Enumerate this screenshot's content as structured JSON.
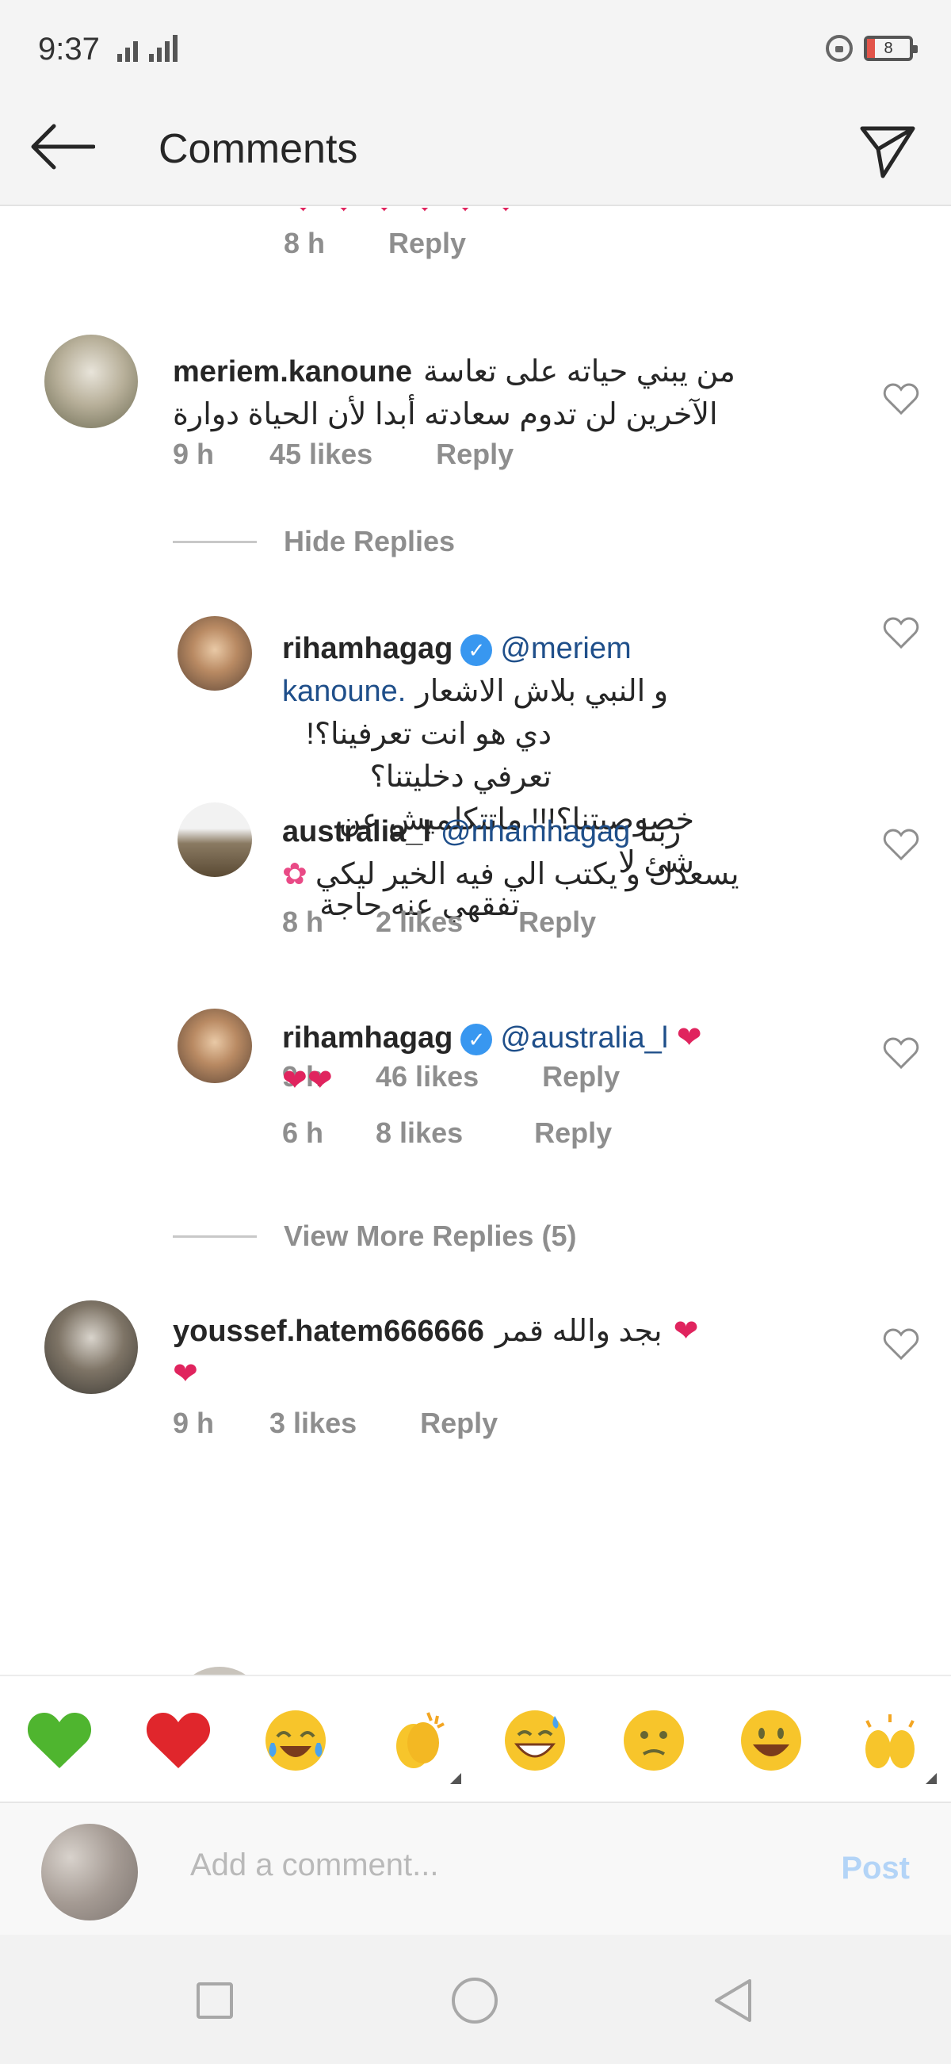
{
  "status_bar": {
    "time": "9:37",
    "battery": "8"
  },
  "header": {
    "title": "Comments"
  },
  "previous_comment": {
    "time": "8 h",
    "reply": "Reply"
  },
  "comments": [
    {
      "username": "meriem.kanoune",
      "text_line1": "من يبني حياته على تعاسة",
      "text_line2": "الآخرين لن تدوم سعادته أبدا لأن الحياة دوارة",
      "time": "9 h",
      "likes": "45 likes",
      "reply": "Reply"
    },
    {
      "username": "youssef.hatem666666",
      "text": "بجد والله قمر",
      "time": "9 h",
      "likes": "3 likes",
      "reply": "Reply"
    }
  ],
  "hide_replies": "Hide Replies",
  "replies": [
    {
      "username": "rihamhagag",
      "mention": "@meriem",
      "line2_rtl": "و النبي بلاش الاشعار",
      "line2_mention": "kanoune.",
      "line3": "دي هو انت تعرفينا؟! تعرفي دخليتنا؟",
      "line4": "خصوصيتنا؟!!! ماتتكلميش عن شئ لا",
      "line5": "تفقهي عنه حاجة",
      "time": "9 h",
      "likes": "46 likes",
      "reply": "Reply"
    },
    {
      "username": "australia_l",
      "mention": "@rihamhagag",
      "text_a": "ربنا",
      "text_b": "يسعدك و  يكتب الي فيه الخير ليكي",
      "time": "8 h",
      "likes": "2 likes",
      "reply": "Reply"
    },
    {
      "username": "rihamhagag",
      "mention": "@australia_l",
      "time": "6 h",
      "likes": "8 likes",
      "reply": "Reply"
    }
  ],
  "view_more_replies": "View More Replies (5)",
  "emoji_bar": [
    "green-heart",
    "red-heart",
    "tears-of-joy",
    "clapping-hands",
    "grinning-sweat",
    "confused-face",
    "grinning-face",
    "raising-hands"
  ],
  "add_comment": {
    "placeholder": "Add a comment...",
    "post": "Post"
  },
  "colors": {
    "accent": "#3897f0",
    "heart": "#e0245e",
    "mention": "#1f4f8a",
    "muted": "#8e8e8e"
  }
}
